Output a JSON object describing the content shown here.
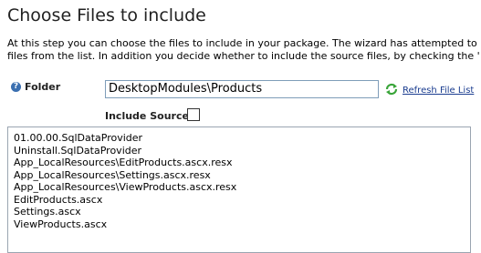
{
  "header": {
    "title": "Choose Files to include"
  },
  "intro": {
    "line1": "At this step you can choose the files to include in your package. The wizard has attempted to",
    "line2": "files from the list. In addition you decide whether to include the source files, by checking the '"
  },
  "folder": {
    "label": "Folder",
    "value": "DesktopModules\\Products",
    "refresh_label": "Refresh File List"
  },
  "include_source": {
    "label": "Include Source:",
    "checked": false
  },
  "files": [
    "01.00.00.SqlDataProvider",
    "Uninstall.SqlDataProvider",
    "App_LocalResources\\EditProducts.ascx.resx",
    "App_LocalResources\\Settings.ascx.resx",
    "App_LocalResources\\ViewProducts.ascx.resx",
    "EditProducts.ascx",
    "Settings.ascx",
    "ViewProducts.ascx"
  ],
  "icons": {
    "help": "help-icon",
    "refresh": "refresh-icon"
  },
  "colors": {
    "link": "#1a3c8f",
    "help_icon": "#3a6fb0",
    "refresh_green": "#3aa53a"
  }
}
